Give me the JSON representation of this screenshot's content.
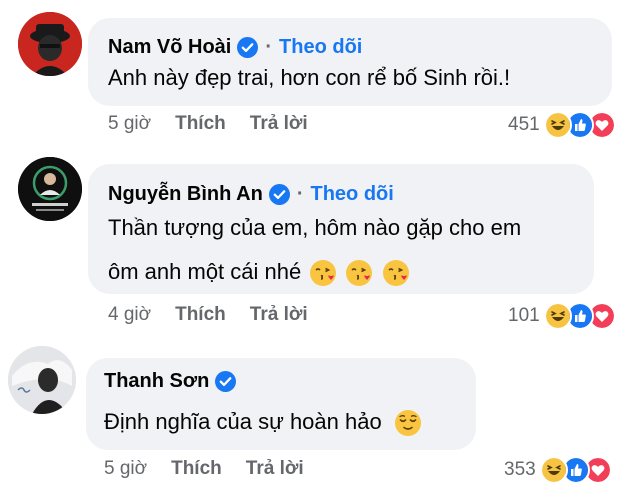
{
  "comments": [
    {
      "author": "Nam Võ Hoài",
      "verified": true,
      "follow_label": "Theo dõi",
      "separator": "·",
      "lines": [
        "Anh này đẹp trai, hơn con rể bố Sinh rồi.!"
      ],
      "time": "5 giờ",
      "like_label": "Thích",
      "reply_label": "Trả lời",
      "reaction_count": "451",
      "reactions": [
        "haha-icon",
        "like-icon",
        "love-icon"
      ]
    },
    {
      "author": "Nguyễn Bình An",
      "verified": true,
      "follow_label": "Theo dõi",
      "separator": "·",
      "lines": [
        "Thần tượng của em, hôm nào gặp cho em",
        "ôm anh một cái nhé"
      ],
      "emojis": [
        "kissing-face-icon",
        "kissing-face-icon",
        "kissing-face-icon"
      ],
      "time": "4 giờ",
      "like_label": "Thích",
      "reply_label": "Trả lời",
      "reaction_count": "101",
      "reactions": [
        "haha-icon",
        "like-icon",
        "love-icon"
      ]
    },
    {
      "author": "Thanh Sơn",
      "verified": true,
      "lines": [
        "Định nghĩa của sự hoàn hảo"
      ],
      "emojis": [
        "relieved-face-icon"
      ],
      "time": "5 giờ",
      "like_label": "Thích",
      "reply_label": "Trả lời",
      "reaction_count": "353",
      "reactions": [
        "haha-icon",
        "like-icon",
        "love-icon"
      ]
    }
  ],
  "colors": {
    "bubble": "#f0f2f5",
    "link_blue": "#1877f2",
    "meta_gray": "#65676b",
    "text": "#050505"
  }
}
